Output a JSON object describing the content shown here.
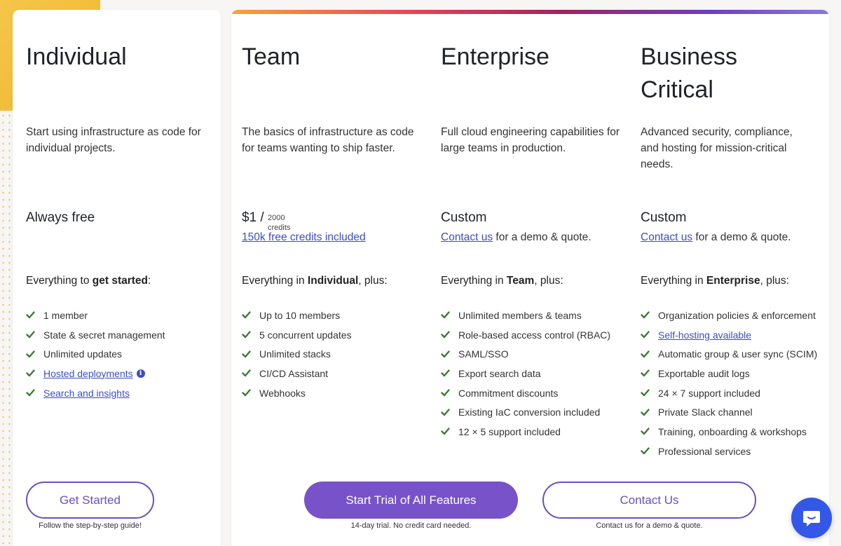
{
  "colors": {
    "accent": "#7752c8",
    "link": "#3a4ec9",
    "check": "#3d7a33",
    "chat": "#3357e6"
  },
  "plans": [
    {
      "name": "Individual",
      "description": "Start using infrastructure as code for individual projects.",
      "price": "Always free",
      "heading_prefix": "Everything to ",
      "heading_bold": "get started",
      "heading_suffix": ":",
      "features": [
        {
          "text": "1 member",
          "link": false
        },
        {
          "text": "State & secret management",
          "link": false
        },
        {
          "text": "Unlimited updates",
          "link": false
        },
        {
          "text": "Hosted deployments",
          "link": true,
          "info_icon": "info-icon"
        },
        {
          "text": "Search and insights",
          "link": true
        }
      ],
      "button_label": "Get Started",
      "button_caption": "Follow the step-by-step guide!"
    },
    {
      "name": "Team",
      "description": "The basics of infrastructure as code for teams wanting to ship faster.",
      "price": "$1 /",
      "price_credits_number": "2000",
      "price_credits_label": "credits",
      "price_link": "150k free credits included",
      "heading_prefix": "Everything in ",
      "heading_bold": "Individual",
      "heading_suffix": ", plus:",
      "features": [
        {
          "text": "Up to 10 members",
          "link": false
        },
        {
          "text": "5 concurrent updates",
          "link": false
        },
        {
          "text": "Unlimited stacks",
          "link": false
        },
        {
          "text": "CI/CD Assistant",
          "link": false
        },
        {
          "text": "Webhooks",
          "link": false
        }
      ],
      "button_label": "Start Trial of All Features",
      "button_caption": "14-day trial. No credit card needed."
    },
    {
      "name": "Enterprise",
      "description": "Full cloud engineering capabilities for large teams in production.",
      "price": "Custom",
      "price_link": "Contact us",
      "price_link_suffix": " for a demo & quote.",
      "heading_prefix": "Everything in ",
      "heading_bold": "Team",
      "heading_suffix": ", plus:",
      "features": [
        {
          "text": "Unlimited members & teams",
          "link": false
        },
        {
          "text": "Role-based access control (RBAC)",
          "link": false
        },
        {
          "text": "SAML/SSO",
          "link": false
        },
        {
          "text": "Export search data",
          "link": false
        },
        {
          "text": "Commitment discounts",
          "link": false
        },
        {
          "text": "Existing IaC conversion included",
          "link": false
        },
        {
          "text": "12 × 5 support included",
          "link": false
        }
      ],
      "button_label": "Contact Us",
      "button_caption": "Contact us for a demo & quote."
    },
    {
      "name": "Business Critical",
      "description": "Advanced security, compliance, and hosting for mission-critical needs.",
      "price": "Custom",
      "price_link": "Contact us",
      "price_link_suffix": " for a demo & quote.",
      "heading_prefix": "Everything in ",
      "heading_bold": "Enterprise",
      "heading_suffix": ", plus:",
      "features": [
        {
          "text": "Organization policies & enforcement",
          "link": false
        },
        {
          "text": "Self-hosting available",
          "link": true
        },
        {
          "text": "Automatic group & user sync (SCIM)",
          "link": false
        },
        {
          "text": "Exportable audit logs",
          "link": false
        },
        {
          "text": "24 × 7 support included",
          "link": false
        },
        {
          "text": "Private Slack channel",
          "link": false
        },
        {
          "text": "Training, onboarding & workshops",
          "link": false
        },
        {
          "text": "Professional services",
          "link": false
        }
      ]
    }
  ],
  "chat_widget": {
    "icon": "chat-bubble-icon"
  }
}
